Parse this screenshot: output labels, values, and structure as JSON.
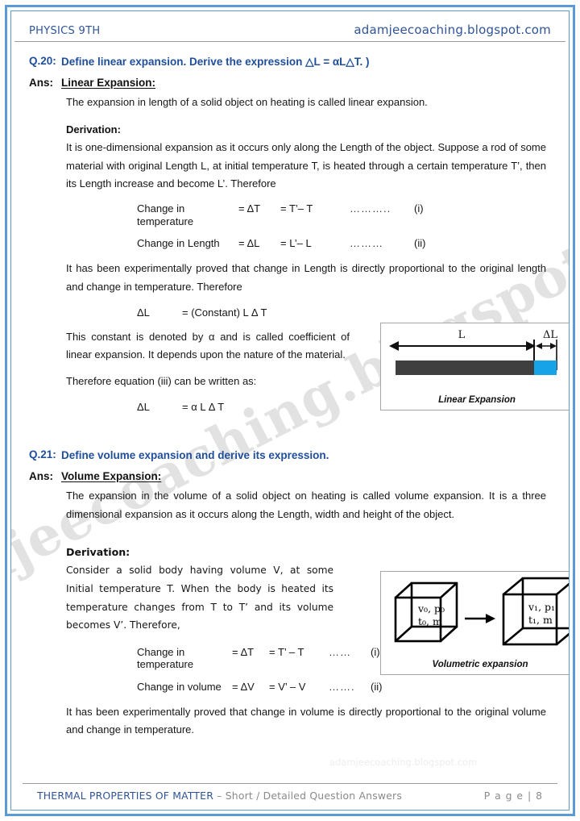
{
  "header": {
    "left": "PHYSICS 9TH",
    "right": "adamjeecoaching.blogspot.com"
  },
  "watermark": {
    "main": "adamjeecoaching.blogspot.com",
    "small": "adamjeecoaching.blogspot.com"
  },
  "q20": {
    "label": "Q.20:",
    "question": "Define linear expansion. Derive the expression △L = αL△T. )",
    "ans_label": "Ans:",
    "ans_heading": "Linear Expansion:",
    "definition": "The expansion in length of a solid object on heating is called linear expansion.",
    "derivation_heading": "Derivation:",
    "derivation_para": "It is one-dimensional expansion as it occurs only along the Length of the object. Suppose a rod of some material with original Length L, at initial temperature T, is heated through a certain temperature T’, then its Length increase and become L’. Therefore",
    "equations": [
      {
        "name": "Change in temperature",
        "symbol": "= ΔT",
        "value": "= T’– T",
        "dots": "………..",
        "number": "(i)"
      },
      {
        "name": "Change in Length",
        "symbol": "= ΔL",
        "value": "= L’– L",
        "dots": "………",
        "number": "(ii)"
      }
    ],
    "proof_para": "It has been experimentally proved that change in Length is directly proportional to the original length and change in temperature. Therefore",
    "eq_constant": {
      "lhs": "ΔL",
      "rhs": "= (Constant) L Δ T"
    },
    "constant_para": "This constant is denoted by α and is called coefficient of linear expansion. It depends upon the nature of the material.",
    "therefore_para": "Therefore equation (iii) can be written as:",
    "eq_final": {
      "lhs": "ΔL",
      "rhs": "= α L Δ T"
    },
    "figure": {
      "caption": "Linear Expansion",
      "label_length": "L",
      "label_delta": "ΔL",
      "rod_color": "#3f3f3f",
      "delta_color": "#17a3e8"
    }
  },
  "q21": {
    "label": "Q.21:",
    "question": "Define volume expansion and derive its expression.",
    "ans_label": "Ans:",
    "ans_heading": "Volume Expansion:",
    "definition": "The expansion in the volume of a solid object on heating is called volume expansion. It is a three dimensional expansion as it occurs along the Length, width and height of the object.",
    "derivation_heading": "Derivation:",
    "derivation_para": "Consider a solid body having volume V, at some Initial temperature T. When the body is heated its temperature changes from T to T’ and its volume becomes V’. Therefore,",
    "equations": [
      {
        "name": "Change in temperature",
        "symbol": "= ΔT",
        "value": "= T’ – T",
        "dots": "……",
        "number": "(i)"
      },
      {
        "name": "Change in volume",
        "symbol": "= ΔV",
        "value": "= V’ – V",
        "dots": "…….",
        "number": "(ii)"
      }
    ],
    "proof_para": "It has been experimentally proved that change in volume is directly proportional to the original volume and change in temperature.",
    "figure": {
      "caption": "Volumetric expansion",
      "cube1_line1": "v₀, p₀",
      "cube1_line2": "t₀, m",
      "cube2_line1": "v₁, p₁",
      "cube2_line2": "t₁, m"
    }
  },
  "footer": {
    "chapter": "THERMAL PROPERTIES OF MATTER",
    "separator": " – ",
    "subtitle": "Short / Detailed Question Answers",
    "page": "P a g e | 8"
  },
  "colors": {
    "frame_blue": "#5b9bd5",
    "heading_blue": "#1f4e9c",
    "header_blue": "#2f5496",
    "muted_gray": "#8a8a8a"
  }
}
